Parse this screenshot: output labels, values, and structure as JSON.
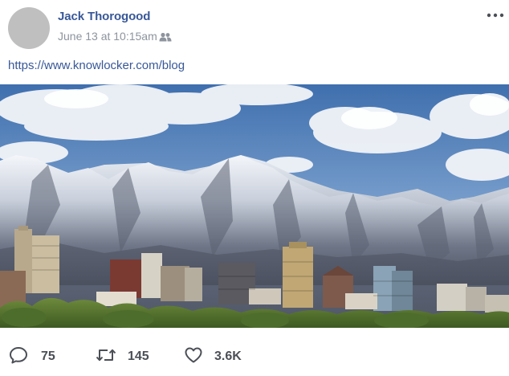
{
  "post": {
    "author": "Jack Thorogood",
    "timestamp": "June 13 at 10:15am",
    "audience_icon": "friends-icon",
    "more_icon": "more-options-icon",
    "link_text": "https://www.knowlocker.com/blog",
    "photo_subject": "city-skyline-mountains-photo"
  },
  "actions": {
    "reply": {
      "icon": "comment-icon",
      "count": "75"
    },
    "retweet": {
      "icon": "retweet-icon",
      "count": "145"
    },
    "like": {
      "icon": "heart-icon",
      "count": "3.6K"
    }
  },
  "colors": {
    "name_link": "#385898",
    "meta_gray": "#8d949e",
    "action_gray": "#4b4f56",
    "avatar_gray": "#bfbfbf"
  }
}
